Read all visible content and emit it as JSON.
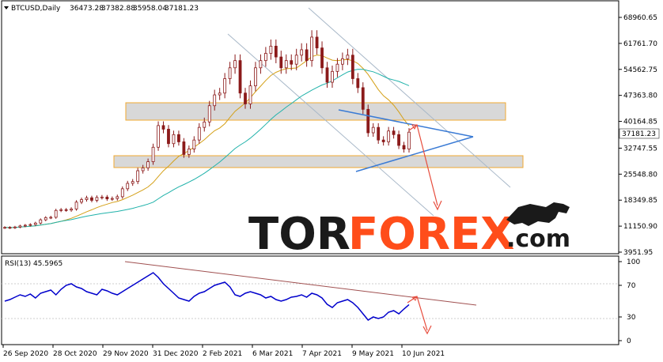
{
  "header": {
    "symbol": "BTCUSD,Daily",
    "open": "36473.28",
    "high": "37382.88",
    "low": "35958.04",
    "close": "37181.23"
  },
  "price_axis": {
    "ticks": [
      "68960.65",
      "61761.70",
      "54562.75",
      "47363.80",
      "40164.85",
      "32747.55",
      "25548.80",
      "18349.85",
      "11150.90",
      "3951.95"
    ],
    "current_price_label": "37181.23"
  },
  "rsi_panel": {
    "label": "RSI(13) 45.5965",
    "ticks": [
      "100",
      "70",
      "30",
      "0"
    ]
  },
  "date_axis": {
    "ticks": [
      "26 Sep 2020",
      "28 Oct 2020",
      "29 Nov 2020",
      "31 Dec 2020",
      "2 Feb 2021",
      "6 Mar 2021",
      "7 Apr 2021",
      "9 May 2021",
      "10 Jun 2021"
    ]
  },
  "watermark": {
    "part1": "TOR",
    "part2": "FOREX",
    "part3": ".com",
    "icon": "bull-icon"
  },
  "colors": {
    "candles": "#8b1a1a",
    "ma_fast": "#d4a017",
    "ma_slow": "#20b2aa",
    "rsi_line": "#0000cc",
    "rsi_trend": "#a05050",
    "channel": "#a8b8c8",
    "triangle": "#3a7bd5",
    "forecast_arrow": "#e74c3c",
    "zone_fill": "#d8d8d8",
    "zone_border": "#f0a830",
    "watermark_dark": "#1a1a1a",
    "watermark_orange": "#ff4d1a"
  },
  "chart_data": [
    {
      "type": "candlestick",
      "series": [
        {
          "values": [
            10800,
            10700,
            10900,
            11200,
            11400,
            11600,
            12000,
            12900,
            13500,
            13600,
            15500,
            15700,
            15600,
            15900,
            17800,
            18500,
            19000,
            18300,
            19100,
            19200,
            18700,
            18800,
            19300,
            21500,
            23000,
            23500,
            26500,
            27300,
            29000,
            33000,
            39000,
            38000,
            34000,
            36500,
            34500,
            31000,
            32500,
            35000,
            38500,
            40000,
            44500,
            47500,
            48000,
            52000,
            55000,
            57000,
            48000,
            45000,
            50000,
            55000,
            57000,
            59000,
            61000,
            58000,
            55000,
            57000,
            56000,
            58500,
            60000,
            57000,
            63500,
            60500,
            55000,
            51000,
            54000,
            56000,
            57500,
            58500,
            52000,
            49500,
            43500,
            37000,
            38500,
            35000,
            34500,
            37500,
            36500,
            33500,
            32500,
            37181
          ]
        }
      ]
    },
    {
      "type": "line",
      "series": [
        {
          "values": [
            50,
            52,
            55,
            58,
            56,
            59,
            54,
            60,
            62,
            64,
            58,
            65,
            70,
            72,
            68,
            66,
            62,
            60,
            58,
            65,
            63,
            60,
            58,
            62,
            66,
            70,
            74,
            78,
            82,
            86,
            80,
            72,
            66,
            60,
            54,
            52,
            50,
            56,
            60,
            62,
            66,
            70,
            72,
            74,
            68,
            58,
            56,
            60,
            62,
            60,
            58,
            54,
            56,
            52,
            50,
            52,
            55,
            56,
            58,
            55,
            60,
            58,
            54,
            46,
            42,
            48,
            50,
            52,
            48,
            42,
            34,
            26,
            30,
            28,
            30,
            36,
            38,
            34,
            40,
            45.5965
          ]
        }
      ],
      "ylim": [
        0,
        100
      ]
    }
  ]
}
